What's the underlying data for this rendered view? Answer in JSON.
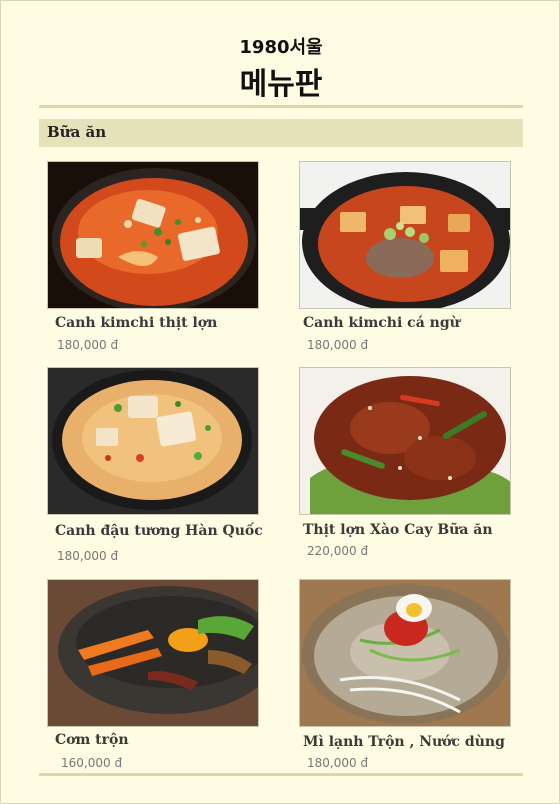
{
  "header": {
    "subtitle": "1980서울",
    "title": "메뉴판"
  },
  "section": {
    "title": "Bữa ăn"
  },
  "items": [
    {
      "name": "Canh kimchi thịt lợn",
      "price": "180,000 đ",
      "icon": "kimchi-pork-stew-photo"
    },
    {
      "name": "Canh kimchi cá ngừ",
      "price": "180,000 đ",
      "icon": "kimchi-tuna-stew-photo"
    },
    {
      "name": "Canh đậu tương Hàn Quốc",
      "price": "180,000 đ",
      "icon": "soybean-paste-stew-photo"
    },
    {
      "name": "Thịt lợn Xào Cay Bữa ăn",
      "price": "220,000 đ",
      "icon": "spicy-stir-fried-pork-photo"
    },
    {
      "name": "Cơm trộn",
      "price": "160,000 đ",
      "icon": "bibimbap-photo"
    },
    {
      "name": "Mì lạnh Trộn , Nước dùng",
      "price": "180,000 đ",
      "icon": "cold-noodles-photo"
    }
  ],
  "colors": {
    "background": "#fefce3",
    "section_bar": "#e5e2b9",
    "rule": "#dcd8a8"
  }
}
